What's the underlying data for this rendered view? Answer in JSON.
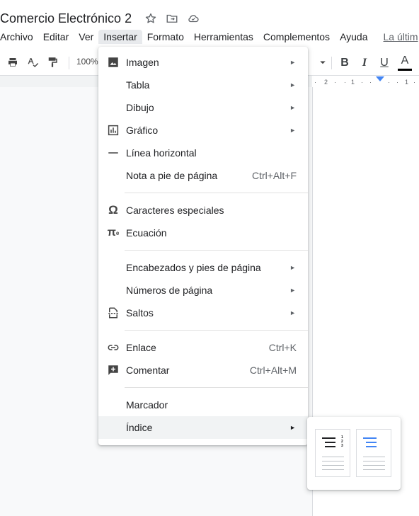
{
  "document": {
    "title": "Comercio Electrónico 2",
    "icons": [
      "star-icon",
      "move-to-folder-icon",
      "cloud-saved-icon"
    ]
  },
  "menubar": {
    "items": [
      "Archivo",
      "Editar",
      "Ver",
      "Insertar",
      "Formato",
      "Herramientas",
      "Complementos",
      "Ayuda"
    ],
    "active": "Insertar",
    "last_edit": "La últim"
  },
  "toolbar": {
    "zoom": "100%",
    "icons": [
      "print-icon",
      "spellcheck-icon",
      "paint-format-icon",
      "dropdown-arrow-icon"
    ],
    "bold": "B",
    "italic": "I",
    "underline": "U",
    "text_color": "A",
    "text_color_value": "#000000"
  },
  "ruler": {
    "ticks": [
      "2",
      "1",
      "1"
    ]
  },
  "insert_menu": {
    "groups": [
      [
        {
          "label": "Imagen",
          "icon": "image-icon",
          "submenu": true
        },
        {
          "label": "Tabla",
          "icon": "",
          "submenu": true
        },
        {
          "label": "Dibujo",
          "icon": "",
          "submenu": true
        },
        {
          "label": "Gráfico",
          "icon": "chart-icon",
          "submenu": true
        },
        {
          "label": "Línea horizontal",
          "icon": "horizontal-line-icon",
          "submenu": false
        },
        {
          "label": "Nota a pie de página",
          "icon": "",
          "shortcut": "Ctrl+Alt+F"
        }
      ],
      [
        {
          "label": "Caracteres especiales",
          "icon": "omega-icon"
        },
        {
          "label": "Ecuación",
          "icon": "pi-icon"
        }
      ],
      [
        {
          "label": "Encabezados y pies de página",
          "icon": "",
          "submenu": true
        },
        {
          "label": "Números de página",
          "icon": "",
          "submenu": true
        },
        {
          "label": "Saltos",
          "icon": "page-break-icon",
          "submenu": true
        }
      ],
      [
        {
          "label": "Enlace",
          "icon": "link-icon",
          "shortcut": "Ctrl+K"
        },
        {
          "label": "Comentar",
          "icon": "add-comment-icon",
          "shortcut": "Ctrl+Alt+M"
        }
      ],
      [
        {
          "label": "Marcador",
          "icon": ""
        },
        {
          "label": "Índice",
          "icon": "",
          "submenu": true,
          "hover": true
        }
      ]
    ]
  },
  "toc_submenu": {
    "options": [
      "toc-with-page-numbers",
      "toc-with-blue-links"
    ],
    "colors": {
      "plain": "#202124",
      "linked": "#4285f4"
    }
  }
}
